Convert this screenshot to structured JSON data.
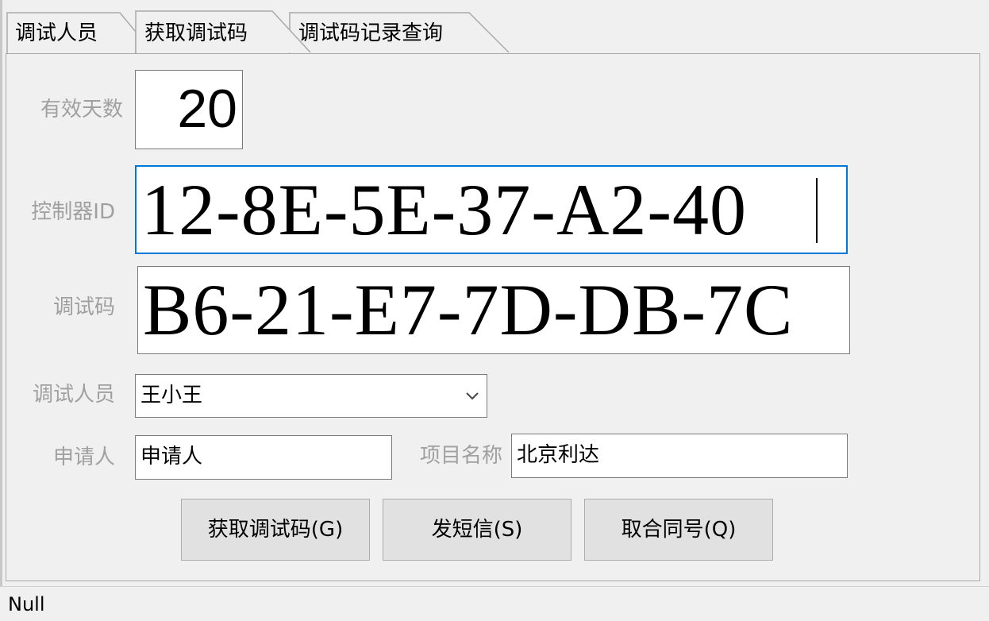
{
  "tabs": [
    {
      "label": "调试人员",
      "selected": false
    },
    {
      "label": "获取调试码",
      "selected": true
    },
    {
      "label": "调试码记录查询",
      "selected": false
    }
  ],
  "form": {
    "valid_days_label": "有效天数",
    "valid_days_value": "20",
    "controller_id_label": "控制器ID",
    "controller_id_value": "12-8E-5E-37-A2-40",
    "debug_code_label": "调试码",
    "debug_code_value": "B6-21-E7-7D-DB-7C",
    "debugger_label": "调试人员",
    "debugger_selected": "王小王",
    "applicant_label": "申请人",
    "applicant_value": "申请人",
    "project_name_label": "项目名称",
    "project_name_value": "北京利达"
  },
  "buttons": {
    "get_code": "获取调试码(G)",
    "send_sms": "发短信(S)",
    "get_contract": "取合同号(Q)"
  },
  "status": {
    "text": "Null"
  },
  "colors": {
    "label_gray": "#a0a0a0",
    "focus_blue": "#0078d7",
    "button_bg": "#e1e1e1",
    "window_bg": "#f0f0f0"
  }
}
